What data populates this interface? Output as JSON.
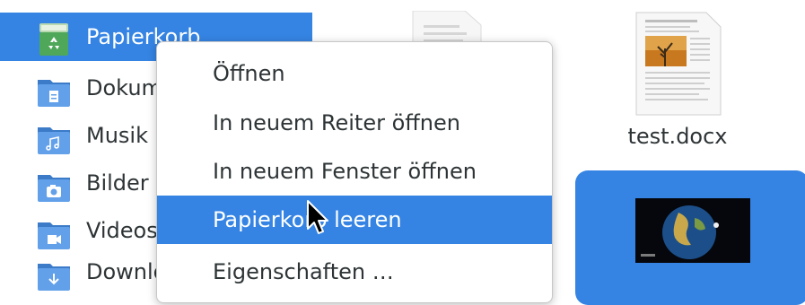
{
  "sidebar": {
    "items": [
      {
        "label": "Papierkorb",
        "icon": "trash-icon"
      },
      {
        "label": "Dokumente",
        "icon": "folder-documents-icon"
      },
      {
        "label": "Musik",
        "icon": "folder-music-icon"
      },
      {
        "label": "Bilder",
        "icon": "folder-pictures-icon"
      },
      {
        "label": "Videos",
        "icon": "folder-videos-icon"
      },
      {
        "label": "Downloads",
        "icon": "folder-downloads-icon"
      }
    ]
  },
  "files": [
    {
      "label": "test.docx",
      "icon": "document-icon"
    },
    {
      "label": "",
      "icon": "video-thumbnail"
    }
  ],
  "context_menu": {
    "items": [
      {
        "label": "Öffnen"
      },
      {
        "label": "In neuem Reiter öffnen"
      },
      {
        "label": "In neuem Fenster öffnen"
      },
      {
        "label": "Papierkorb leeren",
        "highlighted": true
      },
      {
        "label": "Eigenschaften …"
      }
    ]
  },
  "colors": {
    "accent": "#3584e4",
    "folder": "#4a90d9"
  }
}
